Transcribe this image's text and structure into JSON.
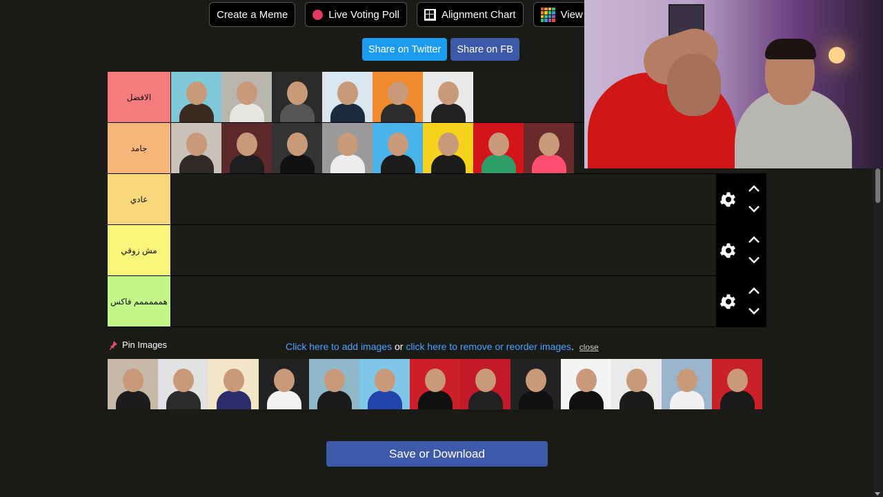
{
  "nav": {
    "create_meme": "Create a Meme",
    "live_voting": "Live Voting Poll",
    "alignment_chart": "Alignment Chart",
    "view": "View C"
  },
  "share": {
    "twitter": "Share on Twitter",
    "facebook": "Share on FB"
  },
  "tiers": [
    {
      "label": "الافضل",
      "color": "#f47c7c",
      "item_count": 6
    },
    {
      "label": "جامد",
      "color": "#f7b77a",
      "item_count": 8
    },
    {
      "label": "عادي",
      "color": "#f7d87a",
      "item_count": 0
    },
    {
      "label": "مش زوقي",
      "color": "#f9f57a",
      "item_count": 0
    },
    {
      "label": "همممممم فاكس",
      "color": "#c3f78a",
      "item_count": 0
    }
  ],
  "pin": {
    "label": "Pin Images",
    "add_images": "Click here to add images",
    "or": "or",
    "remove_reorder": "click here to remove or reorder images",
    "period": ".",
    "close": "close"
  },
  "pool_count": 13,
  "save_label": "Save or Download",
  "colors": {
    "twitter_blue": "#1d9bf0",
    "fb_blue": "#3d5aa8",
    "link_blue": "#4aa3ff"
  }
}
